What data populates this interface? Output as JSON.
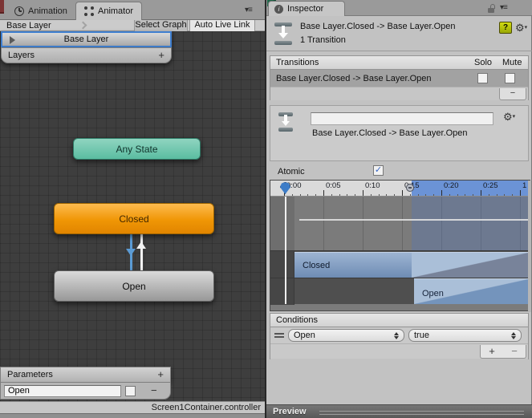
{
  "window": {
    "animator_pane": {
      "tabs": [
        {
          "label": "Animation"
        },
        {
          "label": "Animator"
        }
      ],
      "breadcrumb": "Base Layer",
      "toolbar": {
        "select_graph": "Select Graph",
        "auto_live_link": "Auto Live Link"
      },
      "layer_row": {
        "name": "Base Layer"
      },
      "layers_footer": {
        "label": "Layers",
        "add": "+"
      },
      "graph": {
        "nodes": [
          {
            "id": "any-state",
            "label": "Any State"
          },
          {
            "id": "closed",
            "label": "Closed"
          },
          {
            "id": "open",
            "label": "Open"
          }
        ]
      },
      "parameters": {
        "title": "Parameters",
        "add": "+",
        "rows": [
          {
            "name": "Open",
            "checked": false,
            "remove": "−"
          }
        ]
      },
      "status_bar": {
        "controller": "Screen1Container.controller"
      }
    },
    "inspector_pane": {
      "tab": "Inspector",
      "header": {
        "title": "Base Layer.Closed -> Base Layer.Open",
        "subtitle": "1 Transition"
      },
      "transitions": {
        "title": "Transitions",
        "solo_label": "Solo",
        "mute_label": "Mute",
        "rows": [
          {
            "label": "Base Layer.Closed -> Base Layer.Open",
            "solo": false,
            "mute": false
          }
        ],
        "remove": "−"
      },
      "transition_detail": {
        "name_value": "",
        "label": "Base Layer.Closed -> Base Layer.Open"
      },
      "atomic": {
        "label": "Atomic",
        "checked": true,
        "check_glyph": "✓"
      },
      "timeline": {
        "ticks": [
          "0:00",
          "0:05",
          "0:10",
          "0:15",
          "0:20",
          "0:25",
          "1"
        ],
        "tracks": [
          {
            "label": "Closed"
          },
          {
            "label": "Open"
          }
        ],
        "playhead_time": "0:00"
      },
      "conditions": {
        "title": "Conditions",
        "rows": [
          {
            "parameter": "Open",
            "value": "true"
          }
        ],
        "add": "+",
        "remove": "−"
      },
      "preview": {
        "label": "Preview"
      }
    },
    "colors": {
      "accent_blue": "#3f7fd0",
      "node_orange": "#f09605",
      "node_teal": "#6ec9b2",
      "timeline_blue": "#6b93d6"
    }
  }
}
